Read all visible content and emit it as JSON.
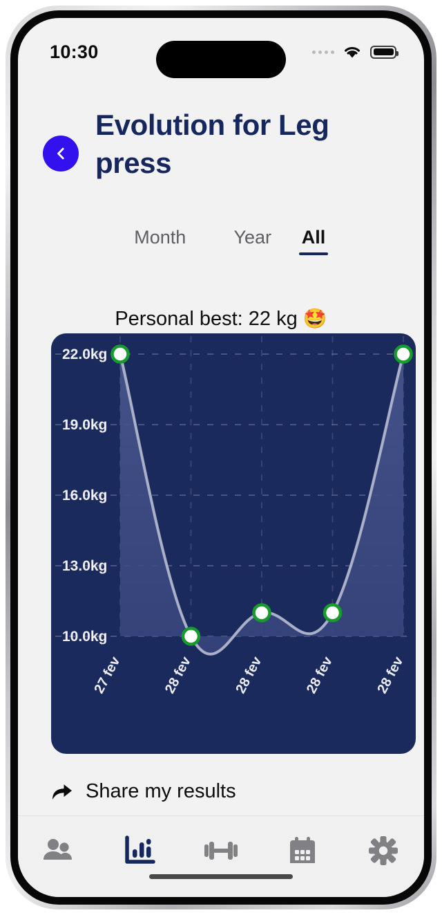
{
  "status_bar": {
    "time": "10:30",
    "signal_icon": "signal-dots-icon",
    "wifi_icon": "wifi-icon",
    "battery_icon": "battery-full-icon"
  },
  "header": {
    "back_icon": "chevron-left-icon",
    "title": "Evolution for Leg press",
    "back_button_color": "#3311ee",
    "title_color": "#16275e"
  },
  "range_tabs": [
    {
      "label": "Month",
      "active": false
    },
    {
      "label": "Year",
      "active": false
    },
    {
      "label": "All",
      "active": true
    }
  ],
  "personal_best": {
    "text": "Personal best: 22 kg",
    "emoji": "🤩"
  },
  "chart_data": {
    "type": "area",
    "title": "",
    "xlabel": "",
    "ylabel": "",
    "categories": [
      "27 fev",
      "28 fev",
      "28 fev",
      "28 fev",
      "28 fev"
    ],
    "values": [
      22.0,
      10.0,
      11.0,
      11.0,
      22.0
    ],
    "ytick_labels": [
      "22.0kg",
      "19.0kg",
      "16.0kg",
      "13.0kg",
      "10.0kg"
    ],
    "ytick_values": [
      22.0,
      19.0,
      16.0,
      13.0,
      10.0
    ],
    "ylim": [
      10.0,
      22.0
    ],
    "grid": true,
    "grid_style": "dashed",
    "legend": "none",
    "xtick_rotation": -62,
    "background_color": "#1b2a5c",
    "area_fill_color": "#33427a",
    "line_color": "#aab0c8",
    "point_fill_color": "#ffffff",
    "point_ring_color": "#169b2c"
  },
  "share": {
    "icon": "share-arrow-icon",
    "label": "Share my results"
  },
  "tab_bar": {
    "items": [
      {
        "name": "friends",
        "icon": "people-icon",
        "active": false
      },
      {
        "name": "stats",
        "icon": "bar-chart-icon",
        "active": true
      },
      {
        "name": "workouts",
        "icon": "dumbbell-icon",
        "active": false
      },
      {
        "name": "calendar",
        "icon": "calendar-icon",
        "active": false
      },
      {
        "name": "settings",
        "icon": "gear-icon",
        "active": false
      }
    ],
    "active_color": "#16275e",
    "inactive_color": "#808085"
  }
}
